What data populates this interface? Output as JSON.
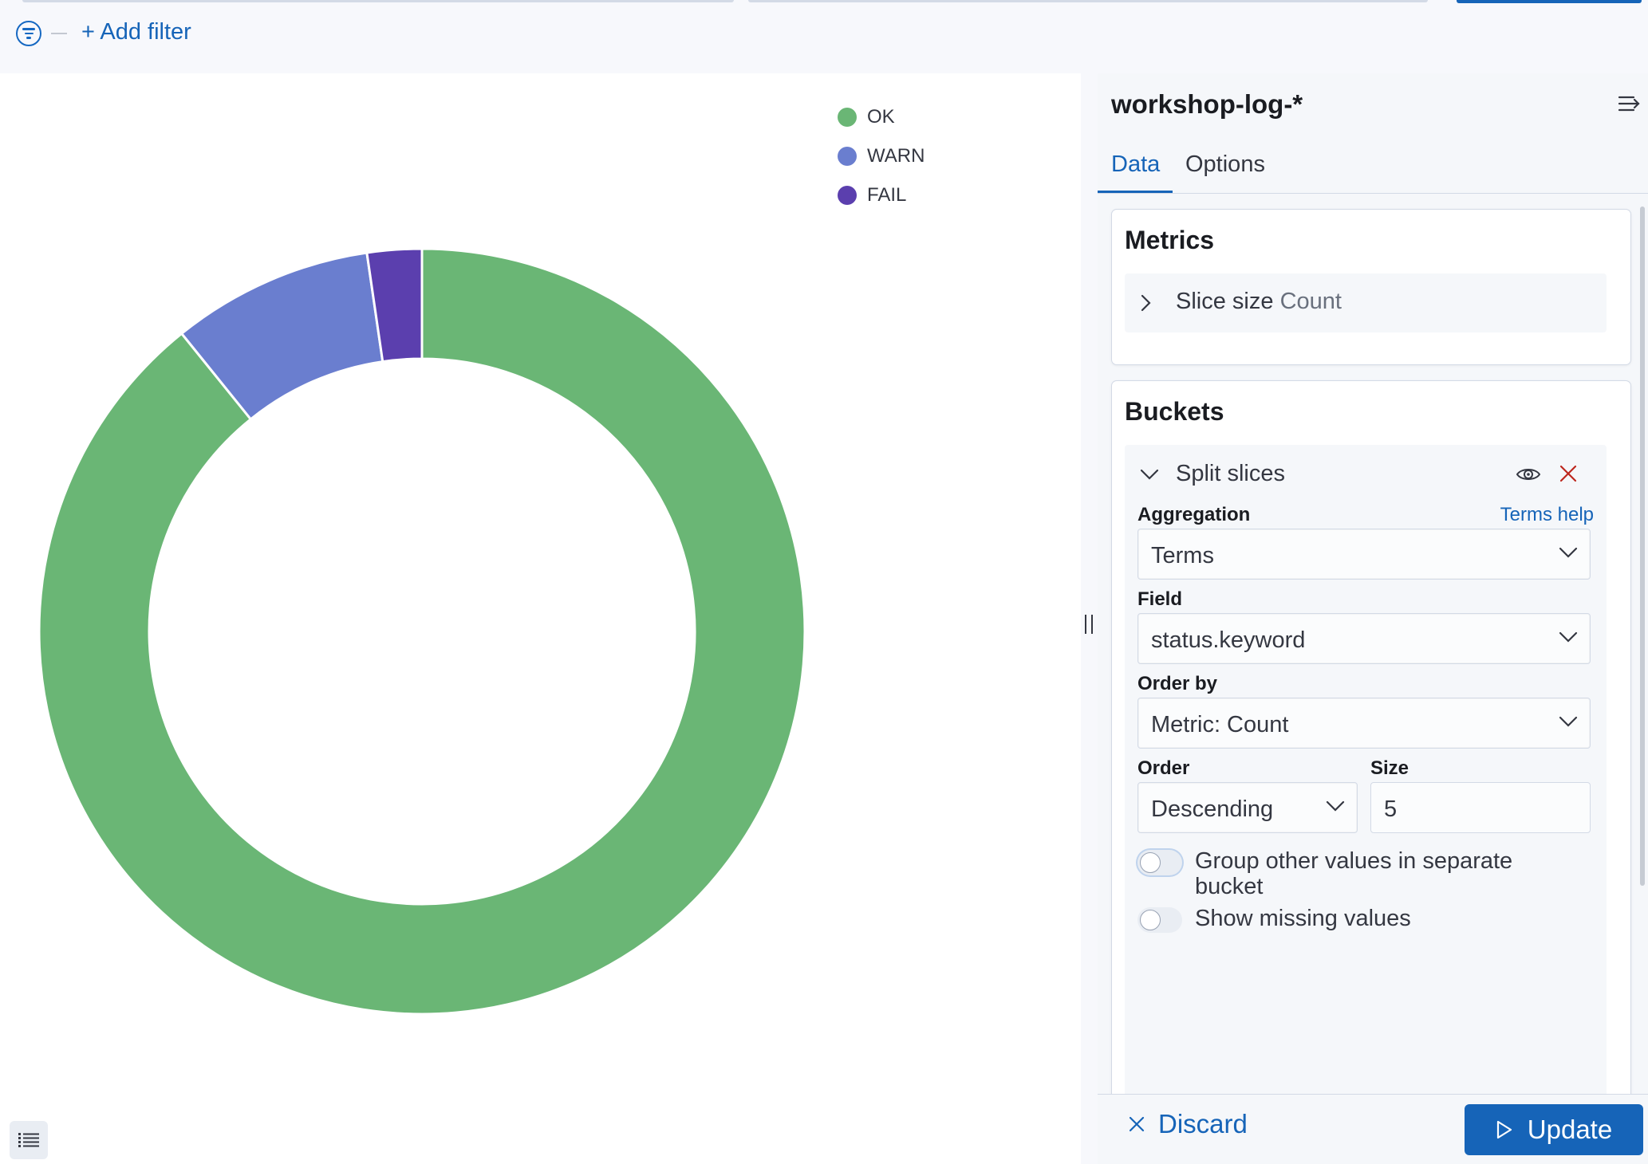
{
  "filter_bar": {
    "add_filter_label": "+ Add filter",
    "filter_icon": "filter-icon"
  },
  "chart_data": {
    "type": "pie",
    "donut": true,
    "categories": [
      "OK",
      "WARN",
      "FAIL"
    ],
    "values": [
      89.2,
      8.5,
      2.3
    ],
    "colors": [
      "#6ab675",
      "#6a7ecf",
      "#5b3fae"
    ],
    "legend_position": "top-right"
  },
  "legend": {
    "items": [
      {
        "label": "OK",
        "color": "#6ab675"
      },
      {
        "label": "WARN",
        "color": "#6a7ecf"
      },
      {
        "label": "FAIL",
        "color": "#5b3fae"
      }
    ],
    "toggle_icon": "list-icon"
  },
  "sidebar": {
    "index_pattern": "workshop-log-*",
    "collapse_icon": "collapse-panel-icon",
    "tabs": [
      {
        "label": "Data",
        "active": true
      },
      {
        "label": "Options",
        "active": false
      }
    ],
    "metrics": {
      "title": "Metrics",
      "item_label": "Slice size",
      "item_sub": "Count"
    },
    "buckets": {
      "title": "Buckets",
      "item_label": "Split slices",
      "aggregation": {
        "label": "Aggregation",
        "help": "Terms help",
        "value": "Terms"
      },
      "field": {
        "label": "Field",
        "value": "status.keyword"
      },
      "order_by": {
        "label": "Order by",
        "value": "Metric: Count"
      },
      "order": {
        "label": "Order",
        "value": "Descending"
      },
      "size": {
        "label": "Size",
        "value": "5"
      },
      "group_other": {
        "label": "Group other values in separate bucket",
        "on": false
      },
      "show_missing": {
        "label": "Show missing values",
        "on": false
      }
    },
    "footer": {
      "discard_label": "Discard",
      "update_label": "Update"
    }
  },
  "colors": {
    "accent": "#1664b8",
    "danger": "#bd271e"
  }
}
